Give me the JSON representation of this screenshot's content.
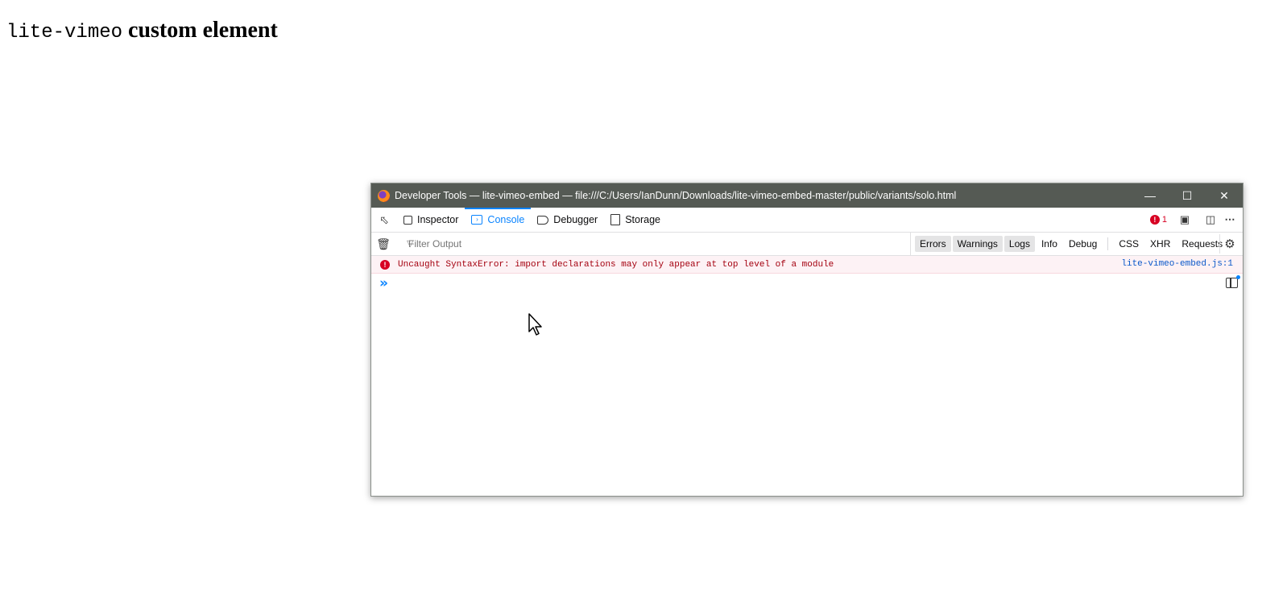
{
  "page": {
    "heading_code": "lite-vimeo",
    "heading_text": " custom element"
  },
  "devtools": {
    "window_title": "Developer Tools — lite-vimeo-embed — file:///C:/Users/IanDunn/Downloads/lite-vimeo-embed-master/public/variants/solo.html",
    "tabs": [
      {
        "label": "Inspector",
        "icon": "inspector-icon",
        "selected": false
      },
      {
        "label": "Console",
        "icon": "console-icon",
        "selected": true
      },
      {
        "label": "Debugger",
        "icon": "debugger-icon",
        "selected": false
      },
      {
        "label": "Storage",
        "icon": "storage-icon",
        "selected": false
      }
    ],
    "error_count": "1",
    "filter_placeholder": "Filter Output",
    "filter_buttons": {
      "errors": "Errors",
      "warnings": "Warnings",
      "logs": "Logs",
      "info": "Info",
      "debug": "Debug",
      "css": "CSS",
      "xhr": "XHR",
      "requests": "Requests"
    },
    "messages": [
      {
        "level": "error",
        "text": "Uncaught SyntaxError: import declarations may only appear at top level of a module",
        "source": "lite-vimeo-embed.js:1"
      }
    ],
    "accent_color": "#0a84ff",
    "error_color": "#d70022"
  }
}
